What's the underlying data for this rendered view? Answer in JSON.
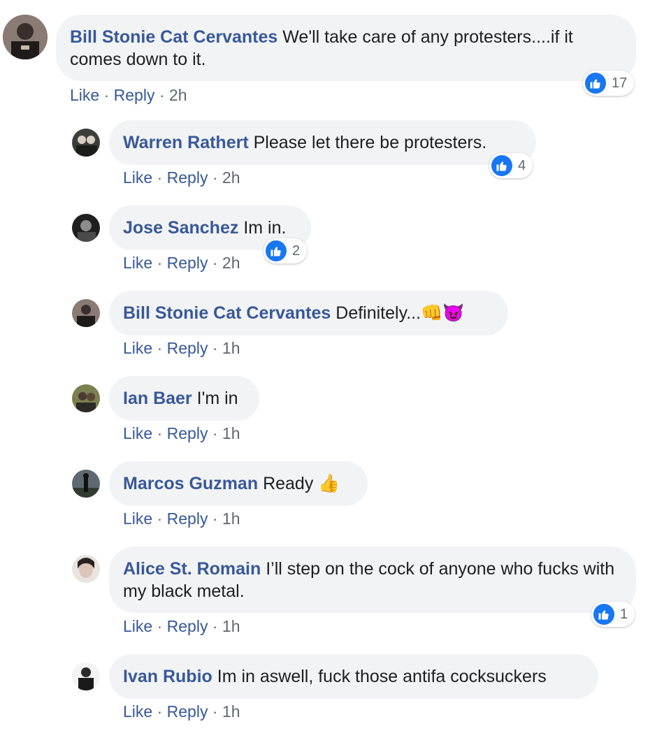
{
  "comments": [
    {
      "name": "Bill Stonie Cat Cervantes",
      "text": "We'll take care of any protesters....if it comes down to it.",
      "like": "Like",
      "reply": "Reply",
      "time": "2h",
      "reactions": "17"
    },
    {
      "name": "Warren Rathert",
      "text": "Please let there be protesters.",
      "like": "Like",
      "reply": "Reply",
      "time": "2h",
      "reactions": "4"
    },
    {
      "name": "Jose Sanchez",
      "text": "Im in.",
      "like": "Like",
      "reply": "Reply",
      "time": "2h",
      "reactions": "2"
    },
    {
      "name": "Bill Stonie Cat Cervantes",
      "text": "Definitely...",
      "emoji": "👊😈",
      "like": "Like",
      "reply": "Reply",
      "time": "1h"
    },
    {
      "name": "Ian Baer",
      "text": "I'm in",
      "like": "Like",
      "reply": "Reply",
      "time": "1h"
    },
    {
      "name": "Marcos Guzman",
      "text": "Ready",
      "emoji": "👍",
      "like": "Like",
      "reply": "Reply",
      "time": "1h"
    },
    {
      "name": "Alice St. Romain",
      "text": "I’ll step on the cock of anyone who fucks with my black metal.",
      "like": "Like",
      "reply": "Reply",
      "time": "1h",
      "reactions": "1"
    },
    {
      "name": "Ivan Rubio",
      "text": "Im in aswell, fuck those antifa cocksuckers",
      "like": "Like",
      "reply": "Reply",
      "time": "1h"
    }
  ],
  "separator": "·",
  "colors": {
    "link": "#385898",
    "bubble": "#f2f3f5",
    "like_blue": "#1877f2"
  },
  "icons": {
    "reaction": "thumbs-up-icon"
  }
}
